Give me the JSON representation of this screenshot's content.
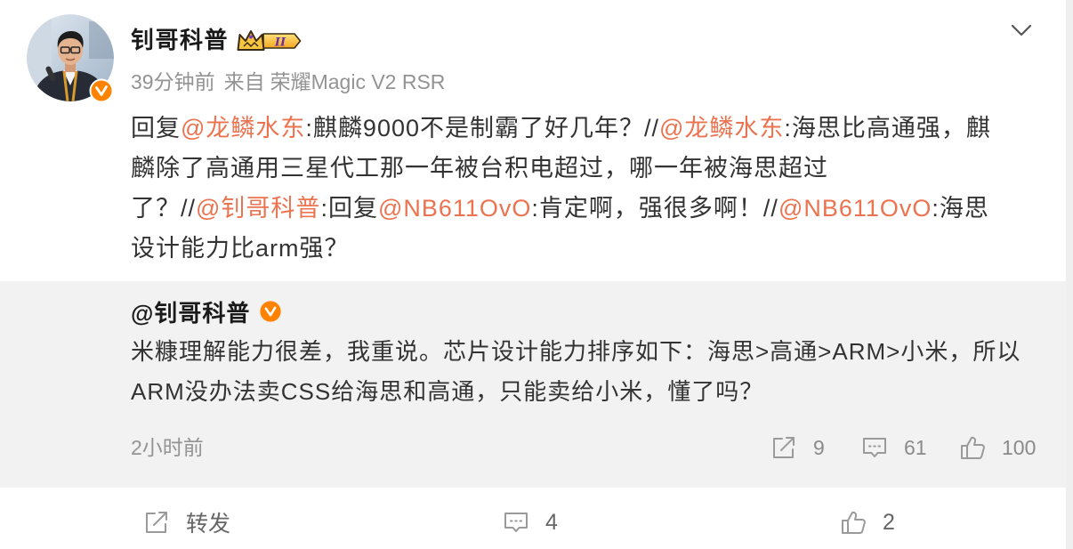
{
  "post": {
    "author": {
      "name": "钊哥科普",
      "badge_level": "II"
    },
    "meta": {
      "time": "39分钟前",
      "source_prefix": "来自",
      "source": "荣耀Magic V2 RSR"
    },
    "lines": [
      [
        {
          "text": "回复",
          "mention": false
        },
        {
          "text": "@龙鳞水东",
          "mention": true
        },
        {
          "text": ":麒麟9000不是制霸了好几年？//",
          "mention": false
        },
        {
          "text": "@龙鳞水东",
          "mention": true
        },
        {
          "text": ":海思比高通强，麒",
          "mention": false
        }
      ],
      [
        {
          "text": "麟除了高通用三星代工那一年被台积电超过，哪一年被海思超过",
          "mention": false
        }
      ],
      [
        {
          "text": "了？//",
          "mention": false
        },
        {
          "text": "@钊哥科普",
          "mention": true
        },
        {
          "text": ":回复",
          "mention": false
        },
        {
          "text": "@NB611OvO",
          "mention": true
        },
        {
          "text": ":肯定啊，强很多啊！//",
          "mention": false
        },
        {
          "text": "@NB611OvO",
          "mention": true
        },
        {
          "text": ":海思",
          "mention": false
        }
      ],
      [
        {
          "text": "设计能力比arm强？",
          "mention": false
        }
      ]
    ]
  },
  "quoted": {
    "author": "@钊哥科普",
    "lines": [
      "米糠理解能力很差，我重说。芯片设计能力排序如下：海思>高通>ARM>小米，所以",
      "ARM没办法卖CSS给海思和高通，只能卖给小米，懂了吗？"
    ],
    "time": "2小时前",
    "repost_count": "9",
    "comment_count": "61",
    "like_count": "100"
  },
  "actions": {
    "repost_label": "转发",
    "comment_count": "4",
    "like_count": "2"
  },
  "icons": {
    "more": "chevron-down-icon",
    "verified": "verified-badge-icon",
    "level_badge": "crown-icon",
    "repost": "repost-icon",
    "comment": "comment-icon",
    "like": "like-icon"
  },
  "colors": {
    "mention": "#eb7350",
    "verified": "#ff8200",
    "quoted_background": "#f2f2f2",
    "meta_text": "#939393"
  }
}
